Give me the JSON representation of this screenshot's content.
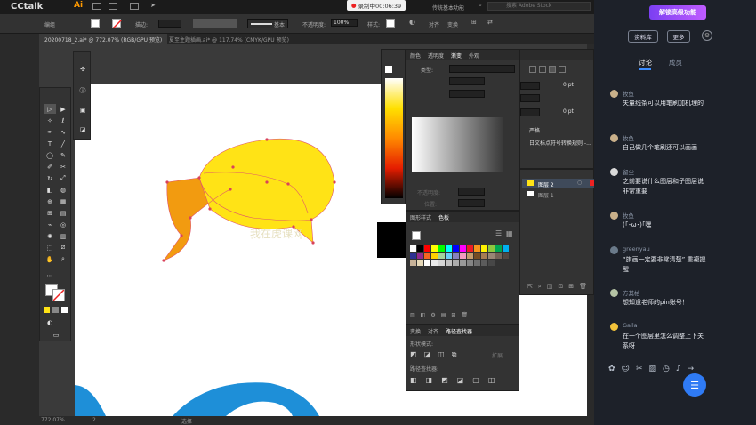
{
  "app": {
    "corner_logo": "CCtalk",
    "ai_logo": "Ai"
  },
  "topbar": {
    "recording_label": "录制中00:06:39",
    "workspace": "传统基本功能",
    "search_placeholder": "搜索 Adobe Stock"
  },
  "control_bar": {
    "selection_label": "编组",
    "stroke_label": "描边:",
    "brush_label": "基本",
    "opacity_label": "不透明度:",
    "opacity_value": "100%",
    "style_label": "样式:",
    "align_label": "对齐",
    "transform_label": "变换"
  },
  "doc_tabs": [
    {
      "label": "20200718_2.ai* @ 772.07% (RGB/GPU 预览)"
    },
    {
      "label": "夏至主题插画.ai* @ 117.74% (CMYK/GPU 预览)"
    }
  ],
  "status": {
    "zoom": "772.07%",
    "page": "2",
    "tool": "选择"
  },
  "color_panel": {
    "tabs": [
      "颜色",
      "透明度",
      "渐变",
      "外观"
    ]
  },
  "gradient_panel": {
    "type_label": "类型:",
    "opacity_label": "不透明度:",
    "position_label": "位置:"
  },
  "char_panel": {
    "pt1": "0 pt",
    "pt2": "0 pt",
    "option1": "严格",
    "option2": "日文标点符号转换规则 -..."
  },
  "layers_panel": {
    "layers": [
      {
        "name": "图层 2"
      },
      {
        "name": "图层 1"
      }
    ]
  },
  "swatches_panel": {
    "tabs": [
      "图形样式",
      "色板"
    ],
    "colors": [
      "#ffffff",
      "#000000",
      "#ff0000",
      "#ffff00",
      "#00ff00",
      "#00ffff",
      "#0000ff",
      "#ff00ff",
      "#ed1c24",
      "#f7941d",
      "#fff200",
      "#8dc63f",
      "#00a651",
      "#00aeef",
      "#2e3192",
      "#92278f",
      "#f26522",
      "#ffd200",
      "#a3d39c",
      "#6dcff6",
      "#8781bd",
      "#f49ac1",
      "#c69c6d",
      "#754c24",
      "#a67c52",
      "#998675",
      "#736357",
      "#534741",
      "#c7b299",
      "#e6d8b8",
      "#ffffff",
      "#ebebeb",
      "#d6d6d6",
      "#c2c2c2",
      "#adadad",
      "#999999",
      "#858585",
      "#707070",
      "#5c5c5c",
      "#474747"
    ]
  },
  "pathfinder_panel": {
    "tabs": [
      "变换",
      "对齐",
      "路径查找器"
    ],
    "shape_modes_label": "形状模式:",
    "expand_label": "扩展",
    "pathfinders_label": "路径查找器:"
  },
  "canvas": {
    "watermark": "我在虎课网"
  },
  "cctalk": {
    "banner": "解锁高级功能",
    "library_button": "资料库",
    "more_button": "更多",
    "tabs": [
      "讨论",
      "成员"
    ],
    "messages": [
      {
        "name": "牧鱼",
        "text": "矢量线条可以用笔刷加机理的"
      },
      {
        "name": "牧鱼",
        "text": "自己做几个笔刷还可以画画"
      },
      {
        "name": "留尘",
        "text": "之前要说什么图层和子图层说非常重要"
      },
      {
        "name": "牧鱼",
        "text": "(｢･ω･)｢嘿"
      },
      {
        "name": "greenyau",
        "text": "“旗画一定要非常清楚” 重複提醒"
      },
      {
        "name": "方其柏",
        "text": "想知道老师的pin账号！"
      },
      {
        "name": "Galla",
        "text": "在一个图层里怎么调整上下关系呀"
      }
    ]
  }
}
